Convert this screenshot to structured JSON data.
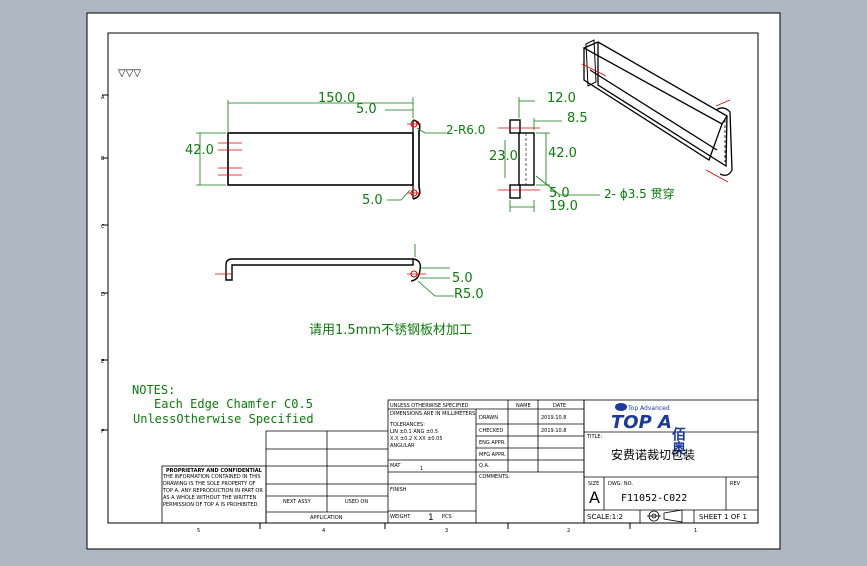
{
  "drawing": {
    "front_view": {
      "dims": {
        "length": "150.0",
        "width": "42.0",
        "offset_top": "5.0",
        "offset_bottom": "5.0",
        "radius": "2-R6.0"
      }
    },
    "side_view": {
      "dims": {
        "top": "12.0",
        "d85": "8.5",
        "d42": "42.0",
        "d23": "23.0",
        "d50": "5.0",
        "d19": "19.0",
        "holes": "2- ϕ3.5 贯穿"
      }
    },
    "bottom_view": {
      "dims": {
        "thickness": "5.0",
        "radius": "R5.0"
      }
    },
    "material_note": "请用1.5mm不锈钢板材加工",
    "notes": {
      "title": "NOTES:",
      "line1": "Each Edge Chamfer C0.5",
      "line2": "UnlessOtherwise Specified"
    },
    "symbol": "▽▽▽",
    "border_numbers": {
      "bottom": [
        "5",
        "4",
        "3",
        "2",
        "1"
      ],
      "left": [
        "A",
        "B",
        "C",
        "D",
        "E",
        "F"
      ]
    }
  },
  "title_block": {
    "header_row": {
      "c1": "UNLESS OTHERWISE SPECIFIED",
      "c2": "NAME",
      "c3": "DATE"
    },
    "dim_label": "DIMENSIONS ARE IN MILLIMETERS",
    "tolerances_label": "TOLERANCES:",
    "tol_lines": [
      "LIN  ±0.1    ANG  ±0.5",
      "X.X ±0.2   X.XX ±0.05",
      "ANGULAR"
    ],
    "drawn": "DRAWN",
    "drawn_date": "2019.10.8",
    "checked": "CHECKED",
    "checked_date": "2019.10.8",
    "eng_appr": "ENG APPR.",
    "mfg_appr": "MFG APPR.",
    "qa": "Q.A.",
    "comments": "COMMENTS:",
    "material_field": "MAT",
    "finish": "FINISH",
    "weight": "WEIGHT",
    "weight_val": "1",
    "pcs": "PCS",
    "next_assy": "NEXT ASSY",
    "used_on": "USED ON",
    "application": "APPLICATION",
    "proprietary": "PROPRIETARY AND CONFIDENTIAL",
    "prop_text": "THE INFORMATION CONTAINED IN THIS DRAWING IS THE SOLE PROPERTY OF TOP A. ANY REPRODUCTION IN PART OR AS A WHOLE WITHOUT THE WRITTEN PERMISSION OF TOP A IS PROHIBITED.",
    "title_label": "TITLE:",
    "title": "安费诺裁切包装",
    "size_label": "SIZE",
    "size": "A",
    "dwg_no_label": "DWG. NO.",
    "dwg_no": "F11052-C022",
    "rev_label": "REV",
    "scale": "SCALE:1:2",
    "sheet": "SHEET 1 OF 1",
    "logo_text": "TOP A",
    "logo_small": "Top Advanced",
    "logo_cn": "佰奥"
  }
}
